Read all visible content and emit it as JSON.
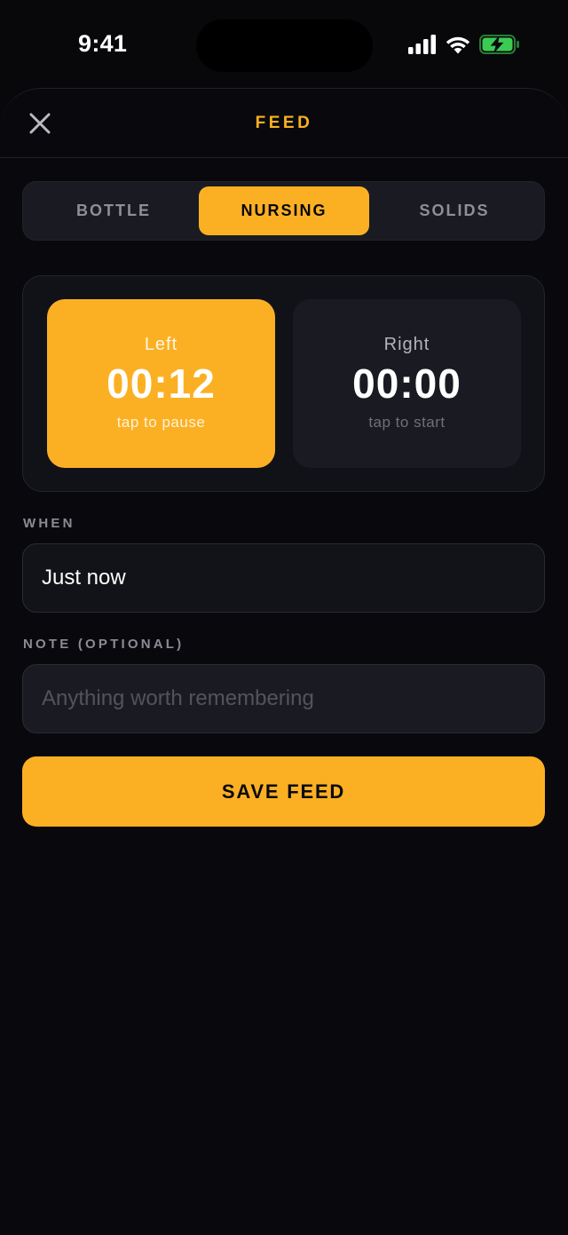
{
  "status_bar": {
    "time": "9:41",
    "icons": [
      "cellular-signal-icon",
      "wifi-icon",
      "battery-charging-icon"
    ],
    "battery_color": "#3CCB52"
  },
  "sheet": {
    "title": "FEED",
    "close_icon": "close-icon"
  },
  "tabs": [
    {
      "label": "BOTTLE",
      "active": false
    },
    {
      "label": "NURSING",
      "active": true
    },
    {
      "label": "SOLIDS",
      "active": false
    }
  ],
  "timers": {
    "left": {
      "side": "Left",
      "time": "00:12",
      "hint": "tap to pause",
      "running": true
    },
    "right": {
      "side": "Right",
      "time": "00:00",
      "hint": "tap to start",
      "running": false
    }
  },
  "form": {
    "when_label": "WHEN",
    "when_value": "Just now",
    "note_label": "NOTE (OPTIONAL)",
    "note_placeholder": "Anything worth remembering"
  },
  "save_button": "SAVE FEED",
  "colors": {
    "accent": "#FBB024",
    "background": "#08080B",
    "surface": "#1A1B22"
  }
}
